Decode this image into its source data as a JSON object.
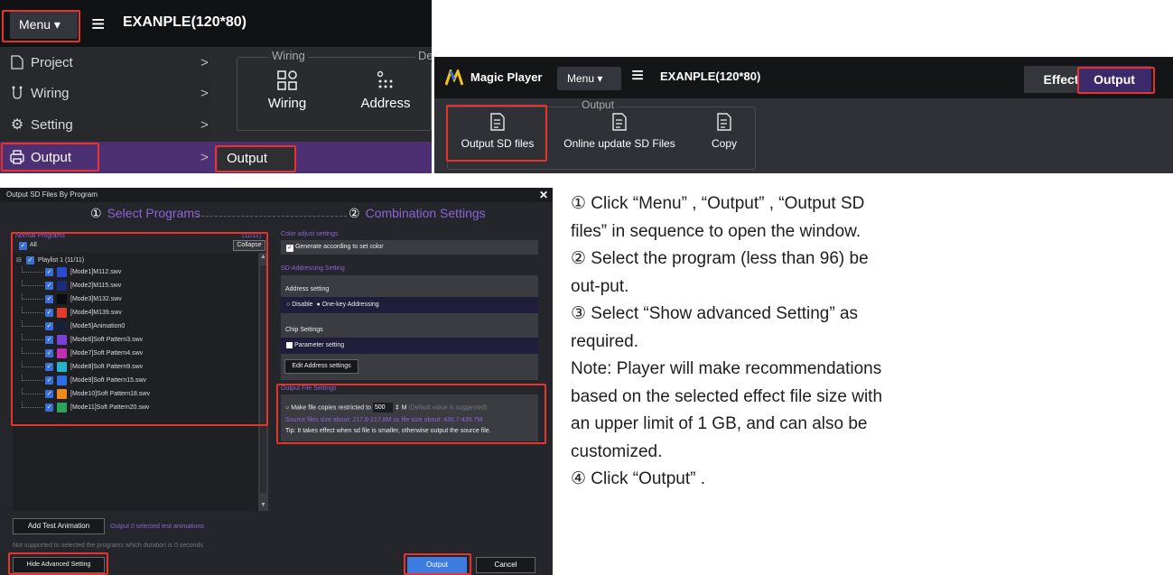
{
  "panel_menu": {
    "menu_label": "Menu ▾",
    "hamburger": "≡",
    "app_title": "EXANPLE(120*80)",
    "items": [
      {
        "icon": "file-icon",
        "glyph": "🗋",
        "label": "Project",
        "chevron": ">"
      },
      {
        "icon": "wiring-icon",
        "glyph": "⫨",
        "label": "Wiring",
        "chevron": ">"
      },
      {
        "icon": "gear-icon",
        "glyph": "⚙",
        "label": "Setting",
        "chevron": ">"
      },
      {
        "icon": "printer-icon",
        "glyph": "⎙",
        "label": "Output",
        "chevron": ">"
      }
    ],
    "ribbon_group_label": "Wiring",
    "ribbon_group_label2": "De",
    "ribbon_buttons": [
      {
        "icon": "grid-icon",
        "glyph": "▣",
        "label": "Wiring"
      },
      {
        "icon": "address-icon",
        "glyph": "∷",
        "label": "Address"
      }
    ],
    "submenu_output": "Output"
  },
  "panel_player": {
    "brand": "Magic Player",
    "menu_label": "Menu ▾",
    "hamburger": "≡",
    "app_title": "EXANPLE(120*80)",
    "tabs": [
      "Effect",
      "Output"
    ],
    "group_label": "Output",
    "buttons": [
      {
        "icon": "export-file-icon",
        "glyph": "🖹",
        "label": "Output SD files"
      },
      {
        "icon": "export-file-icon",
        "glyph": "🖹",
        "label": "Online update SD Files"
      },
      {
        "icon": "export-file-icon",
        "glyph": "🖹",
        "label": "Copy"
      }
    ]
  },
  "dialog": {
    "title": "Output SD Files By Program",
    "close": "✕",
    "step1": {
      "num": "①",
      "label": "Select Programs"
    },
    "step2": {
      "num": "②",
      "label": "Combination Settings"
    },
    "normal_programs": "Normal Programs",
    "count": "(11/11)",
    "all_label": "All",
    "collapse": "Collapse",
    "playlist": "Playlist 1 (11/11)",
    "programs": [
      {
        "label": "[Mode1]M112.swv",
        "color": "#2a4bd1"
      },
      {
        "label": "[Mode2]M115.swv",
        "color": "#1d2c7a"
      },
      {
        "label": "[Mode3]M132.swv",
        "color": "#0c0c0c"
      },
      {
        "label": "[Mode4]M139.swv",
        "color": "#e43a2a"
      },
      {
        "label": "[Mode5]Animation0",
        "color": "#18213c"
      },
      {
        "label": "[Mode6]Soft Pattern3.swv",
        "color": "#7b3fd6"
      },
      {
        "label": "[Mode7]Soft Pattern4.swv",
        "color": "#c12fb6"
      },
      {
        "label": "[Mode8]Soft Pattern9.swv",
        "color": "#26b5c8"
      },
      {
        "label": "[Mode9]Soft Pattern15.swv",
        "color": "#2a6ee8"
      },
      {
        "label": "[Mode10]Soft Pattern18.swv",
        "color": "#f08a1a"
      },
      {
        "label": "[Mode11]Soft Pattern20.swv",
        "color": "#2ca35a"
      }
    ],
    "add_test": "Add Test Animation",
    "test_note": "Output 0 selected test animations",
    "not_supported": "Not supported to selected the programs which duration is 0 seconds",
    "hide_adv": "Hide Advanced Setting",
    "color_adjust": "Color adjust settings",
    "generate": "Generate according to set color",
    "sd_addressing": "SD-Addressing Setting",
    "address_setting": "Address setting",
    "addr_disable": "Disable",
    "addr_onekey": "One-key Addressing",
    "chip_settings": "Chip Settings",
    "param_setting": "Parameter setting",
    "edit_address": "Edit Address settings",
    "output_file_settings": "Output File Settings",
    "restrict_prefix": "Make file copies restricted to",
    "restrict_value": "500",
    "restrict_unit": "M",
    "restrict_hint": "(Default value is suggested)",
    "size_info": "Source files size about: 217.8-217.8M ss file size about: 435.7-435.7M",
    "tip": "Tip: It takes effect when sd file is smaller, otherwise output the source file.",
    "btn_output": "Output",
    "btn_cancel": "Cancel"
  },
  "instructions": [
    "① Click “Menu” , “Output” , “Output SD",
    "files” in sequence to open the window.",
    "② Select the program (less than 96) be",
    "out-put.",
    "③ Select “Show advanced Setting” as",
    "required.",
    "Note: Player will make recommendations",
    "based on the selected effect file size with",
    "an upper limit of 1 GB, and can also be",
    "customized.",
    "④ Click “Output” ."
  ],
  "colors": {
    "highlight": "#e8332c",
    "accent_purple": "#8e63d6",
    "primary_blue": "#3c7be0"
  }
}
